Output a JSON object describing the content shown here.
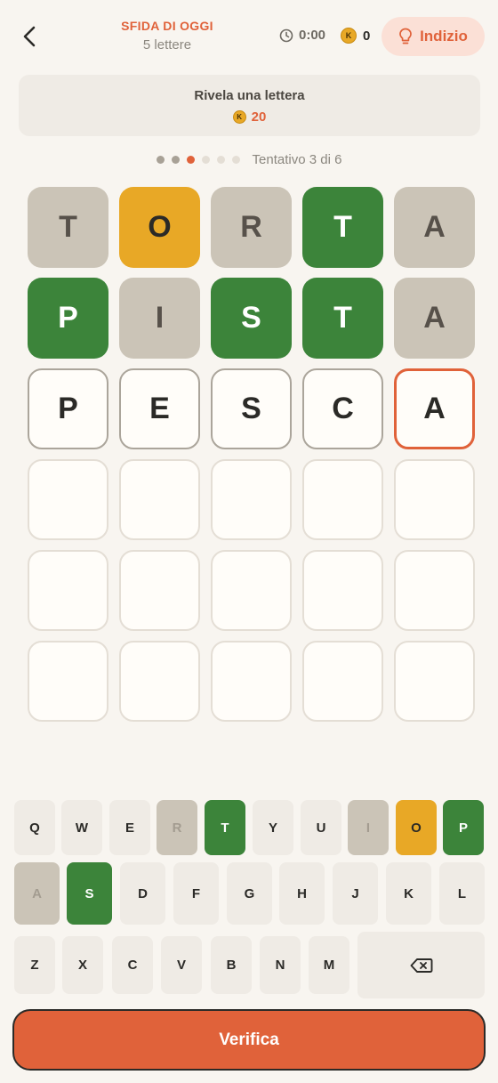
{
  "header": {
    "title": "SFIDA DI OGGI",
    "subtitle": "5 lettere",
    "timer": "0:00",
    "coin_symbol": "K",
    "coins": "0",
    "hint_label": "Indizio"
  },
  "reveal": {
    "title": "Rivela una lettera",
    "coin_symbol": "K",
    "cost": "20"
  },
  "progress": {
    "attempt_label": "Tentativo 3 di 6",
    "current": 3,
    "total": 6
  },
  "board": {
    "rows": [
      [
        {
          "l": "T",
          "s": "absent"
        },
        {
          "l": "O",
          "s": "present"
        },
        {
          "l": "R",
          "s": "absent"
        },
        {
          "l": "T",
          "s": "correct"
        },
        {
          "l": "A",
          "s": "absent"
        }
      ],
      [
        {
          "l": "P",
          "s": "correct"
        },
        {
          "l": "I",
          "s": "absent"
        },
        {
          "l": "S",
          "s": "correct"
        },
        {
          "l": "T",
          "s": "correct"
        },
        {
          "l": "A",
          "s": "absent"
        }
      ],
      [
        {
          "l": "P",
          "s": "typed"
        },
        {
          "l": "E",
          "s": "typed"
        },
        {
          "l": "S",
          "s": "typed"
        },
        {
          "l": "C",
          "s": "typed"
        },
        {
          "l": "A",
          "s": "active"
        }
      ],
      [
        {
          "l": "",
          "s": "empty"
        },
        {
          "l": "",
          "s": "empty"
        },
        {
          "l": "",
          "s": "empty"
        },
        {
          "l": "",
          "s": "empty"
        },
        {
          "l": "",
          "s": "empty"
        }
      ],
      [
        {
          "l": "",
          "s": "empty"
        },
        {
          "l": "",
          "s": "empty"
        },
        {
          "l": "",
          "s": "empty"
        },
        {
          "l": "",
          "s": "empty"
        },
        {
          "l": "",
          "s": "empty"
        }
      ],
      [
        {
          "l": "",
          "s": "empty"
        },
        {
          "l": "",
          "s": "empty"
        },
        {
          "l": "",
          "s": "empty"
        },
        {
          "l": "",
          "s": "empty"
        },
        {
          "l": "",
          "s": "empty"
        }
      ]
    ]
  },
  "keyboard": {
    "rows": [
      [
        {
          "k": "Q",
          "s": ""
        },
        {
          "k": "W",
          "s": ""
        },
        {
          "k": "E",
          "s": ""
        },
        {
          "k": "R",
          "s": "absent"
        },
        {
          "k": "T",
          "s": "correct"
        },
        {
          "k": "Y",
          "s": ""
        },
        {
          "k": "U",
          "s": ""
        },
        {
          "k": "I",
          "s": "absent"
        },
        {
          "k": "O",
          "s": "present"
        },
        {
          "k": "P",
          "s": "correct"
        }
      ],
      [
        {
          "k": "A",
          "s": "absent"
        },
        {
          "k": "S",
          "s": "correct"
        },
        {
          "k": "D",
          "s": ""
        },
        {
          "k": "F",
          "s": ""
        },
        {
          "k": "G",
          "s": ""
        },
        {
          "k": "H",
          "s": ""
        },
        {
          "k": "J",
          "s": ""
        },
        {
          "k": "K",
          "s": ""
        },
        {
          "k": "L",
          "s": ""
        }
      ],
      [
        {
          "k": "Z",
          "s": ""
        },
        {
          "k": "X",
          "s": ""
        },
        {
          "k": "C",
          "s": ""
        },
        {
          "k": "V",
          "s": ""
        },
        {
          "k": "B",
          "s": ""
        },
        {
          "k": "N",
          "s": ""
        },
        {
          "k": "M",
          "s": ""
        }
      ]
    ],
    "backspace_icon": "backspace-icon"
  },
  "verify_label": "Verifica",
  "colors": {
    "accent": "#E0623A",
    "correct": "#3C843A",
    "present": "#E8A826",
    "absent": "#CBC4B7"
  }
}
